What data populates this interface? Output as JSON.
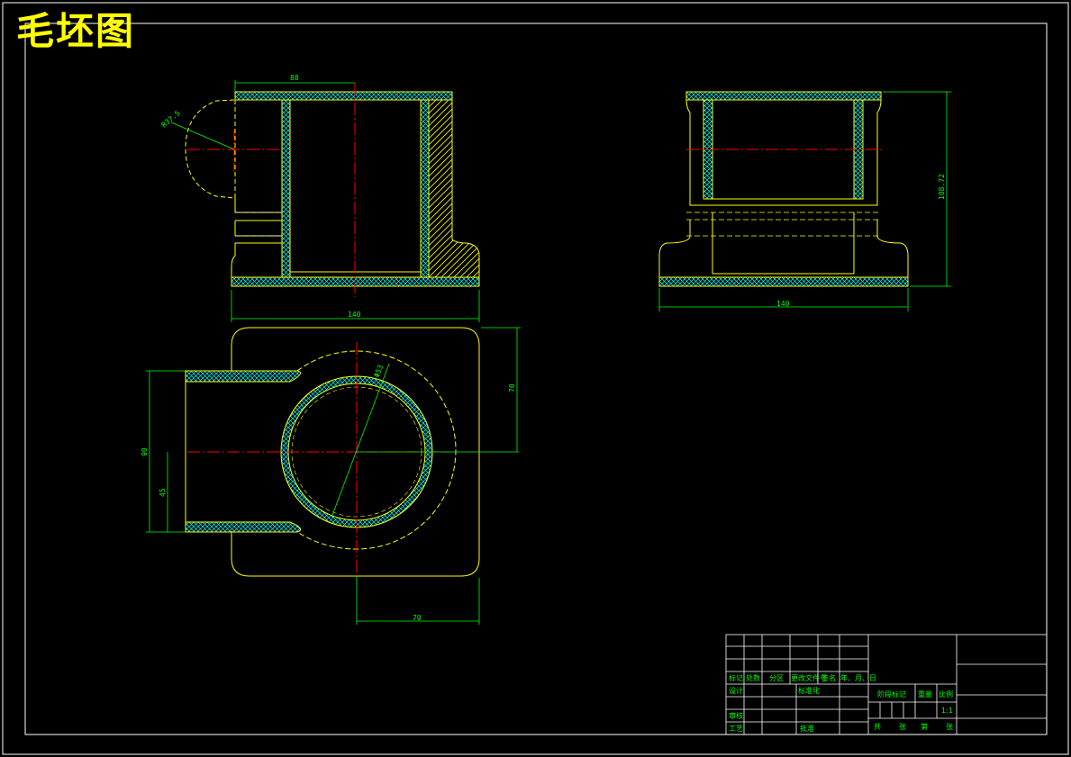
{
  "title": "毛坯图",
  "colors": {
    "background": "#000000",
    "outline": "#ffff00",
    "dimension": "#00ff00",
    "centerline": "#ff0000",
    "hatch": "#00ffff",
    "border": "#ffffff"
  },
  "dimensions": {
    "front_top": "88",
    "front_radius": "R37.5",
    "front_width": "140",
    "side_height": "108.72",
    "side_width": "140",
    "top_diameter": "Φ53",
    "top_height_upper": "70",
    "top_height_left": "90",
    "top_height_inner": "45",
    "top_bottom": "70"
  },
  "title_block": {
    "mark": "标记",
    "count": "处数",
    "zone": "分区",
    "doc_no": "更改文件号",
    "sign": "签名",
    "date": "年、月、日",
    "design": "设计",
    "standardize": "标准化",
    "review": "审核",
    "process": "工艺",
    "approve": "批准",
    "stage_mark": "阶段标记",
    "weight": "重量",
    "scale": "比例",
    "scale_value": "1:1",
    "total": "共",
    "sheet_unit": "张",
    "sheet_no": "第",
    "sheet_unit2": "张"
  }
}
